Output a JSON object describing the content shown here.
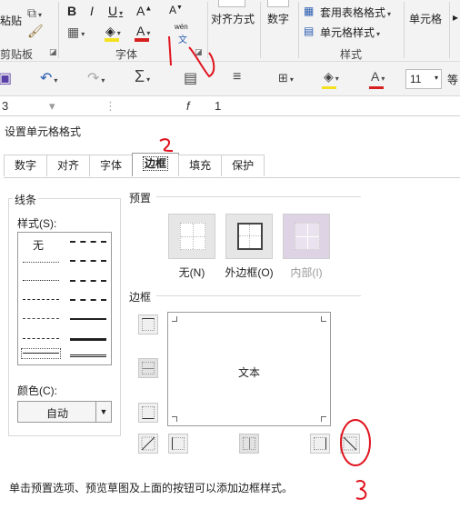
{
  "ribbon": {
    "paste_label": "粘贴",
    "clipboard_label": "剪贴板",
    "font_group_label": "字体",
    "style_group_label": "样式",
    "align_label": "对齐方式",
    "number_label": "数字",
    "table_format_label": "套用表格格式",
    "cell_style_label": "单元格样式",
    "cell_label": "单元格",
    "bold": "B",
    "italic": "I",
    "underline": "U",
    "grow_font": "A",
    "shrink_font": "A",
    "wen_label": "wén",
    "wen_char": "文",
    "font_color_letter": "A"
  },
  "qat": {
    "font_size": "11",
    "extra": "等"
  },
  "formula_bar": {
    "cell_ref": "3",
    "fx": "f",
    "value": "1"
  },
  "dialog": {
    "title": "设置单元格格式",
    "tabs": [
      "数字",
      "对齐",
      "字体",
      "边框",
      "填充",
      "保护"
    ],
    "line_section": "线条",
    "style_label": "样式(S):",
    "style_none": "无",
    "color_label": "颜色(C):",
    "color_value": "自动",
    "presets_section": "预置",
    "presets": [
      {
        "label": "无(N)"
      },
      {
        "label": "外边框(O)"
      },
      {
        "label": "内部(I)"
      }
    ],
    "border_section": "边框",
    "preview_text": "文本",
    "hint": "单击预置选项、预览草图及上面的按钮可以添加边框样式。"
  },
  "annotations": {
    "mark_1": "1",
    "mark_2": "2",
    "mark_3": "3"
  },
  "colors": {
    "accent_red": "#e0141e",
    "font_color_bar": "#d61f1f",
    "highlight_bar": "#f5e020"
  }
}
